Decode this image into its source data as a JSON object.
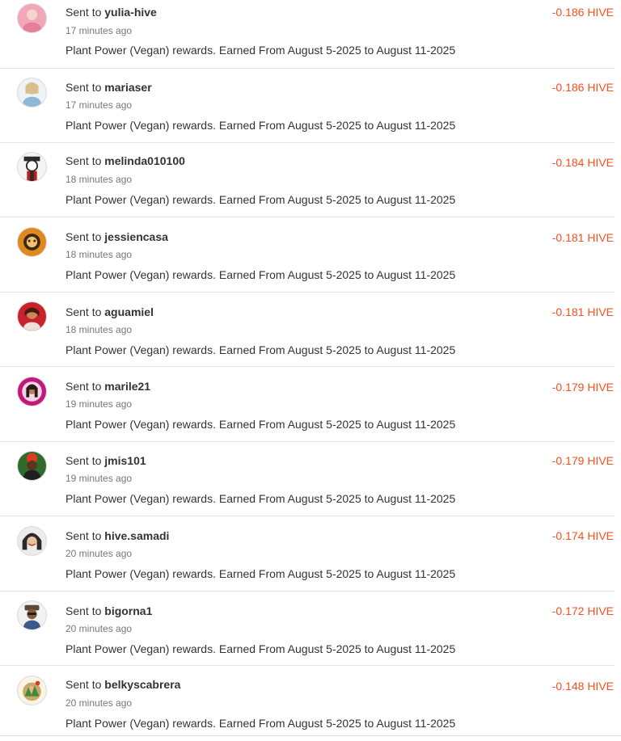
{
  "transactions": [
    {
      "prefix": "Sent to",
      "user": "yulia-hive",
      "time": "17 minutes ago",
      "memo": "Plant Power (Vegan) rewards. Earned From August 5-2025 to August 11-2025",
      "amount": "-0.186 HIVE",
      "avatar_color": "#f2a7b8"
    },
    {
      "prefix": "Sent to",
      "user": "mariaser",
      "time": "17 minutes ago",
      "memo": "Plant Power (Vegan) rewards. Earned From August 5-2025 to August 11-2025",
      "amount": "-0.186 HIVE",
      "avatar_color": "#d9c08a"
    },
    {
      "prefix": "Sent to",
      "user": "melinda010100",
      "time": "18 minutes ago",
      "memo": "Plant Power (Vegan) rewards. Earned From August 5-2025 to August 11-2025",
      "amount": "-0.184 HIVE",
      "avatar_color": "#2b2b2b"
    },
    {
      "prefix": "Sent to",
      "user": "jessiencasa",
      "time": "18 minutes ago",
      "memo": "Plant Power (Vegan) rewards. Earned From August 5-2025 to August 11-2025",
      "amount": "-0.181 HIVE",
      "avatar_color": "#e08a1e"
    },
    {
      "prefix": "Sent to",
      "user": "aguamiel",
      "time": "18 minutes ago",
      "memo": "Plant Power (Vegan) rewards. Earned From August 5-2025 to August 11-2025",
      "amount": "-0.181 HIVE",
      "avatar_color": "#c8232c"
    },
    {
      "prefix": "Sent to",
      "user": "marile21",
      "time": "19 minutes ago",
      "memo": "Plant Power (Vegan) rewards. Earned From August 5-2025 to August 11-2025",
      "amount": "-0.179 HIVE",
      "avatar_color": "#c2187a"
    },
    {
      "prefix": "Sent to",
      "user": "jmis101",
      "time": "19 minutes ago",
      "memo": "Plant Power (Vegan) rewards. Earned From August 5-2025 to August 11-2025",
      "amount": "-0.179 HIVE",
      "avatar_color": "#2f6b2a"
    },
    {
      "prefix": "Sent to",
      "user": "hive.samadi",
      "time": "20 minutes ago",
      "memo": "Plant Power (Vegan) rewards. Earned From August 5-2025 to August 11-2025",
      "amount": "-0.174 HIVE",
      "avatar_color": "#3a3a3a"
    },
    {
      "prefix": "Sent to",
      "user": "bigorna1",
      "time": "20 minutes ago",
      "memo": "Plant Power (Vegan) rewards. Earned From August 5-2025 to August 11-2025",
      "amount": "-0.172 HIVE",
      "avatar_color": "#5a4a3a"
    },
    {
      "prefix": "Sent to",
      "user": "belkyscabrera",
      "time": "20 minutes ago",
      "memo": "Plant Power (Vegan) rewards. Earned From August 5-2025 to August 11-2025",
      "amount": "-0.148 HIVE",
      "avatar_color": "#c9a86a"
    }
  ],
  "colors": {
    "amount": "#f4511e",
    "divider": "#e3e3e3"
  }
}
